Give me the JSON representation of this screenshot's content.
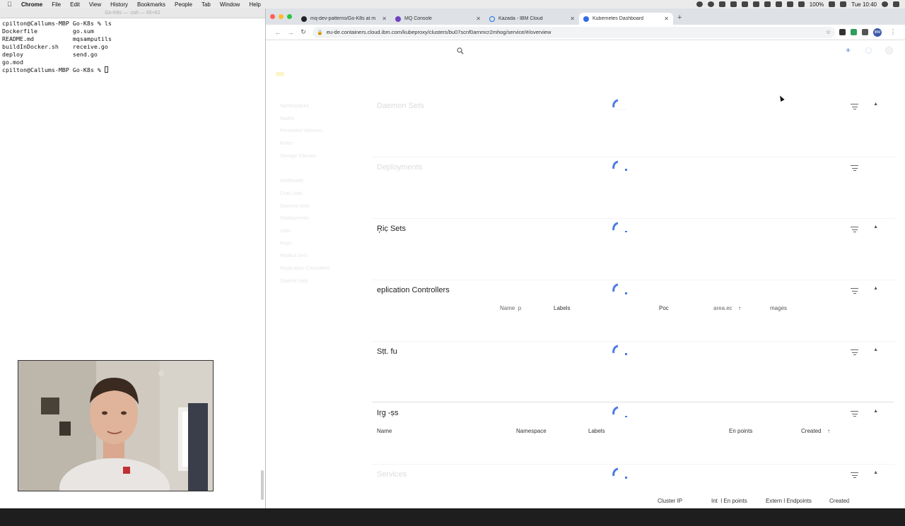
{
  "menubar": {
    "app": "Chrome",
    "items": [
      "File",
      "Edit",
      "View",
      "History",
      "Bookmarks",
      "People",
      "Tab",
      "Window",
      "Help"
    ],
    "battery": "100%",
    "clock": "Tue 10:40"
  },
  "terminal": {
    "title": "Go-K8s — -zsh — 65×62",
    "lines": [
      "cpilton@Callums-MBP Go-K8s % ls",
      "Dockerfile          go.sum",
      "README.md           mqsamputils",
      "buildInDocker.sh    receive.go",
      "deploy              send.go",
      "go.mod",
      "cpilton@Callums-MBP Go-K8s % "
    ]
  },
  "browser": {
    "tabs": [
      {
        "label": "mq-dev-patterns/Go-K8s at m",
        "color": "#222222"
      },
      {
        "label": "MQ Console",
        "color": "#6f42c1"
      },
      {
        "label": "Kazada - IBM Cloud",
        "color": "#1a73e8"
      },
      {
        "label": "Kubernetes Dashboard",
        "color": "#326ce5"
      }
    ],
    "active_tab": 3,
    "url": "eu-de.containers.cloud.ibm.com/kubeproxy/clusters/bu07scnf0arnmcr2mhog/service/#/overview"
  },
  "dashboard": {
    "sections": [
      {
        "title": "Daemon Sets",
        "faint": true,
        "columns": []
      },
      {
        "title": "Deployments",
        "faint": true,
        "columns": []
      },
      {
        "title": "R̩̣ic̣ Sets",
        "faint": false,
        "columns": []
      },
      {
        "title": "eplication Controllers",
        "faint": false,
        "columns": [
          "Name  p",
          "Labels",
          "Poc",
          "area.ec",
          "↑",
          "mages"
        ]
      },
      {
        "title": "Sṭt. fu",
        "faint": false,
        "columns": []
      },
      {
        "title": "Iṛg̣ -ṣs",
        "faint": false,
        "columns": [
          "Name",
          "Namespace",
          "Labels",
          "En points",
          "Created",
          "↑"
        ]
      },
      {
        "title": "Services",
        "faint": true,
        "columns": [
          "Cluster IP",
          "Int  l En points",
          "Extern l Endpoints",
          "Created",
          "↑"
        ]
      }
    ],
    "side_nav": [
      "Namespaces",
      "Nodes",
      "Persistent Volumes",
      "Roles",
      "Storage Classes",
      "",
      "Workloads",
      "Cron Jobs",
      "Daemon Sets",
      "Deployments",
      "Jobs",
      "Pods",
      "Replica Sets",
      "Replication Controllers",
      "Stateful Sets"
    ]
  }
}
